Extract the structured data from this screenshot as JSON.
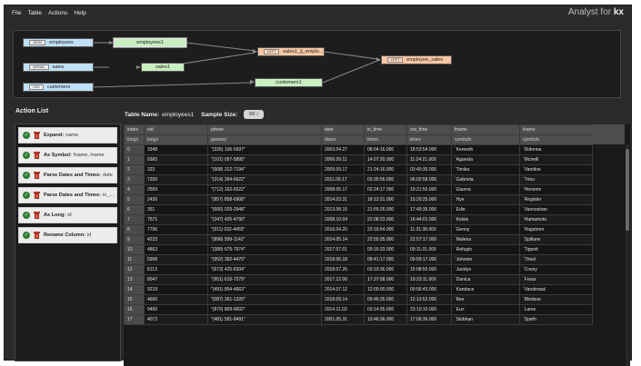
{
  "menu": [
    "File",
    "Table",
    "Actions",
    "Help"
  ],
  "brand": {
    "prefix": "Analyst for ",
    "suffix": "kx"
  },
  "pipeline": {
    "sources": [
      {
        "tag": "JSON",
        "label": "employees"
      },
      {
        "tag": "SERIAL",
        "label": "sales"
      },
      {
        "tag": "CSV",
        "label": "customers"
      }
    ],
    "transforms": [
      {
        "label": "employees1",
        "selected": true
      },
      {
        "label": "sales1",
        "selected": false
      },
      {
        "label": "customers1",
        "selected": false
      }
    ],
    "joins": [
      {
        "tag": "LEFT",
        "label": "sales1_lj_emplo..."
      },
      {
        "tag": "LEFT",
        "label": "employee_sales"
      }
    ]
  },
  "action_list": {
    "title": "Action List",
    "items": [
      {
        "name": "Expand:",
        "detail": "name"
      },
      {
        "name": "As Symbol:",
        "detail": "fname, lname"
      },
      {
        "name": "Parse Dates and Times:",
        "detail": "date"
      },
      {
        "name": "Parse Dates and Times:",
        "detail": "in_..."
      },
      {
        "name": "As Long:",
        "detail": "id"
      },
      {
        "name": "Rename Column:",
        "detail": "id"
      }
    ]
  },
  "table_header": {
    "name_label": "Table Name:",
    "name_value": "employees1",
    "size_label": "Sample Size:",
    "size_value": "50"
  },
  "grid": {
    "columns": [
      "index",
      "eid",
      "phone",
      "date",
      "in_time",
      "out_time",
      "fname",
      "lname"
    ],
    "types": [
      "longs",
      "longs",
      "general",
      "dates",
      "times",
      "times",
      "symbols",
      "symbols"
    ],
    "rows": [
      [
        "0",
        "3348",
        "\"(326) 106-5697\"",
        "2003.04.27",
        "08:04:16.000",
        "18:53:54.000",
        "`Kenneth",
        "`Didonna"
      ],
      [
        "1",
        "9365",
        "\"(101) 057-5895\"",
        "2006.09.11",
        "14:07:20.000",
        "11:24:21.000",
        "`Aguesta",
        "`Mcneill"
      ],
      [
        "2",
        "323",
        "\"(908) 312-7194\"",
        "2009.09.17",
        "21:24:16.000",
        "03:40:30.000",
        "`Timika",
        "`Vandine"
      ],
      [
        "3",
        "7200",
        "\"(314) 284-6622\"",
        "2011.09.17",
        "03:35:56.000",
        "06:02:58.000",
        "`Gabriela",
        "`Trieu"
      ],
      [
        "4",
        "2569",
        "\"(712) 162-6522\"",
        "2008.05.17",
        "02:24:17.000",
        "19:21:50.000",
        "`Gianna",
        "`Hensom"
      ],
      [
        "5",
        "2430",
        "\"(857) 858-6908\"",
        "2014.03.31",
        "18:12:31.000",
        "15:20:25.000",
        "`Hye",
        "`Register"
      ],
      [
        "6",
        "351",
        "\"(666) 029-2948\"",
        "2013.08.15",
        "21:55:26.000",
        "17:49:35.000",
        "`Edie",
        "`Vannostran"
      ],
      [
        "7",
        "7571",
        "\"(347) 425-4790\"",
        "2008.10.04",
        "22:08:23.000",
        "16:44:01.000",
        "`Kelsie",
        "`Hamamoto"
      ],
      [
        "8",
        "7796",
        "\"(911) 032-4455\"",
        "2016.04.20",
        "23:16:54.000",
        "11:31:38.000",
        "`Genny",
        "`Hagstrom"
      ],
      [
        "9",
        "4223",
        "\"(898) 599-1142\"",
        "2014.05.14",
        "22:55:35.000",
        "22:57:17.000",
        "`Malena",
        "`Spillane"
      ],
      [
        "10",
        "4863",
        "\"(389) 675-7974\"",
        "2017.07.01",
        "09:16:33.000",
        "00:11:31.000",
        "`Refugio",
        "`Tippett"
      ],
      [
        "11",
        "5908",
        "\"(952) 382-4470\"",
        "2018.06.18",
        "08:41:17.000",
        "09:59:17.000",
        "`Johnnie",
        "`Theel"
      ],
      [
        "12",
        "8113",
        "\"(673) 425-8304\"",
        "2018.07.26",
        "03:19:36.000",
        "15:08:50.000",
        "`Jacklyn",
        "`Covey"
      ],
      [
        "13",
        "8047",
        "\"(951) 615-7279\"",
        "2017.12.06",
        "17:37:58.000",
        "19:23:11.000",
        "`Danica",
        "`Freas"
      ],
      [
        "14",
        "9219",
        "\"(491) 854-4663\"",
        "2014.07.12",
        "12:09:00.000",
        "00:56:43.000",
        "`Kandace",
        "`Vanderwal"
      ],
      [
        "15",
        "4600",
        "\"(087) 361-1320\"",
        "2018.09.14",
        "09:46:35.000",
        "12:13:52.000",
        "`Bee",
        "`Bledsoe"
      ],
      [
        "16",
        "9490",
        "\"(879) 809-6602\"",
        "2014.11.03",
        "03:14:35.000",
        "23:10:10.000",
        "`Eun",
        "`Lares"
      ],
      [
        "17",
        "4072",
        "\"(481) 581-8491\"",
        "2001.05.31",
        "19:46:36.000",
        "17:06:36.000",
        "`Siobhan",
        "`Speth"
      ]
    ]
  }
}
